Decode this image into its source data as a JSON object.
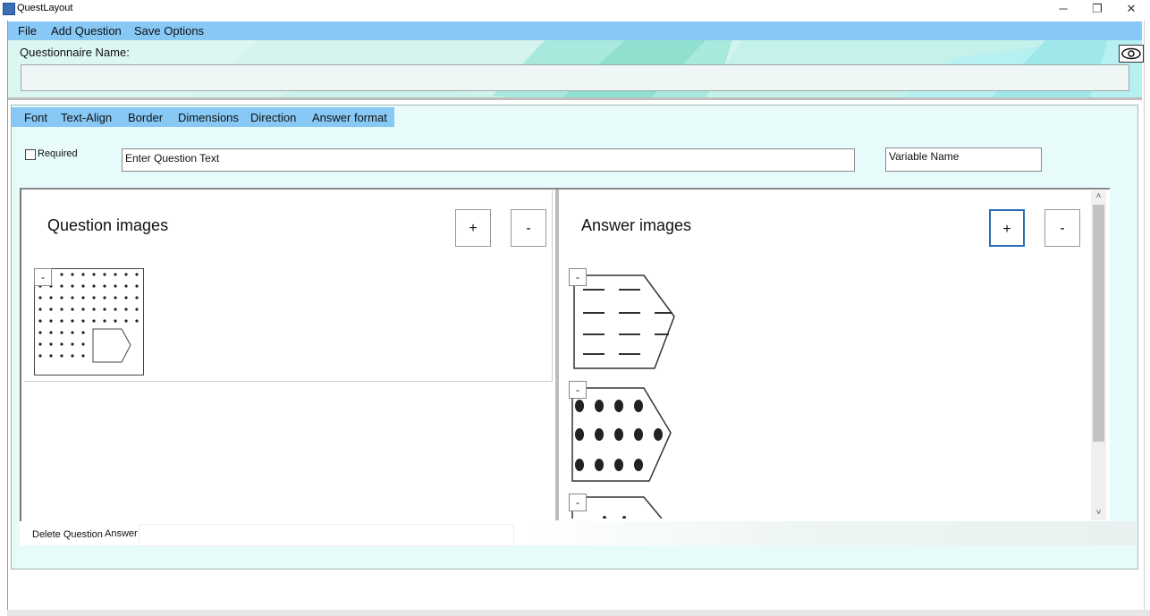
{
  "window": {
    "title": "QuestLayout",
    "controls": {
      "minimize": "─",
      "restore": "❐",
      "close": "✕"
    }
  },
  "menubar": {
    "items": [
      {
        "label": "File"
      },
      {
        "label": "Add Question"
      },
      {
        "label": "Save Options"
      }
    ]
  },
  "questionnaire": {
    "name_label": "Questionnaire Name:",
    "name_value": "",
    "preview_icon": "eye-icon"
  },
  "format_menu": {
    "items": [
      {
        "label": "Font"
      },
      {
        "label": "Text-Align"
      },
      {
        "label": "Border"
      },
      {
        "label": "Dimensions"
      },
      {
        "label": "Direction"
      },
      {
        "label": "Answer format"
      }
    ]
  },
  "question": {
    "required_label": "Required",
    "required_checked": false,
    "text_value": "Enter Question Text",
    "variable_value": "Variable Name"
  },
  "question_images": {
    "title": "Question images",
    "add_label": "+",
    "remove_label": "-",
    "items": [
      {
        "remove_label": "-"
      }
    ]
  },
  "answer_images": {
    "title": "Answer images",
    "add_label": "+",
    "remove_label": "-",
    "items": [
      {
        "remove_label": "-"
      },
      {
        "remove_label": "-"
      },
      {
        "remove_label": "-"
      }
    ]
  },
  "scrollbar": {
    "up": "˄",
    "down": "˅"
  },
  "footer": {
    "delete_label": "Delete Question",
    "answer_label": "Answer",
    "answer_value": ""
  },
  "colors": {
    "menubar": "#87c8f5",
    "banner": "#d6f4ee",
    "editor_bg": "#e7fbfb",
    "focus": "#2a6cb8"
  }
}
